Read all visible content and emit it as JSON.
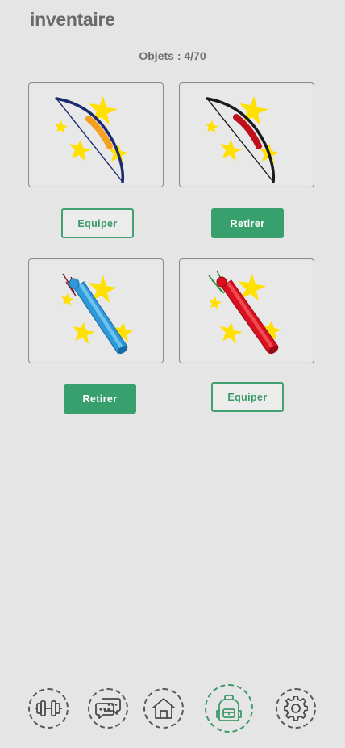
{
  "header": {
    "title": "inventaire"
  },
  "inventory": {
    "counter": "Objets : 4/70"
  },
  "items": [
    {
      "name": "arc-orange",
      "action": "Equiper",
      "state": "unequipped"
    },
    {
      "name": "arc-rouge",
      "action": "Retirer",
      "state": "equipped"
    },
    {
      "name": "carquois-bleu",
      "action": "Retirer",
      "state": "equipped"
    },
    {
      "name": "carquois-rouge",
      "action": "Equiper",
      "state": "unequipped"
    }
  ],
  "colors": {
    "accent": "#37a06d",
    "sparkle": "#ffe000",
    "bow_grip_orange": "#f5a020",
    "bow_grip_red": "#c0101c",
    "quiver_blue": "#2e98d8",
    "quiver_red": "#d81020"
  },
  "nav": {
    "items": [
      {
        "icon": "dumbbell-icon"
      },
      {
        "icon": "chat-icon"
      },
      {
        "icon": "home-icon"
      },
      {
        "icon": "backpack-icon",
        "active": true
      },
      {
        "icon": "gear-icon"
      }
    ]
  }
}
